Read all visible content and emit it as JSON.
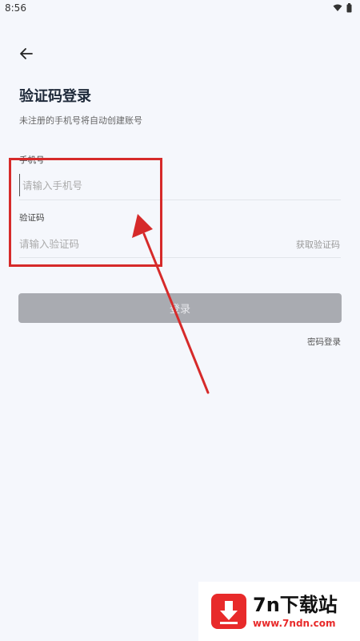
{
  "status": {
    "time": "8:56"
  },
  "header": {
    "back_icon": "arrow-left-icon"
  },
  "title": "验证码登录",
  "subtitle": "未注册的手机号将自动创建账号",
  "phone": {
    "label": "手机号",
    "placeholder": "请输入手机号",
    "value": ""
  },
  "code": {
    "label": "验证码",
    "placeholder": "请输入验证码",
    "value": "",
    "get_code": "获取验证码"
  },
  "login_button": "登录",
  "password_login": "密码登录",
  "watermark": {
    "name": "7n下载站",
    "url": "www.7ndn.com"
  },
  "colors": {
    "background": "#f5f7fc",
    "button": "#a9abb1",
    "annotation": "#d62a2a",
    "watermark_red": "#e82a2a"
  }
}
